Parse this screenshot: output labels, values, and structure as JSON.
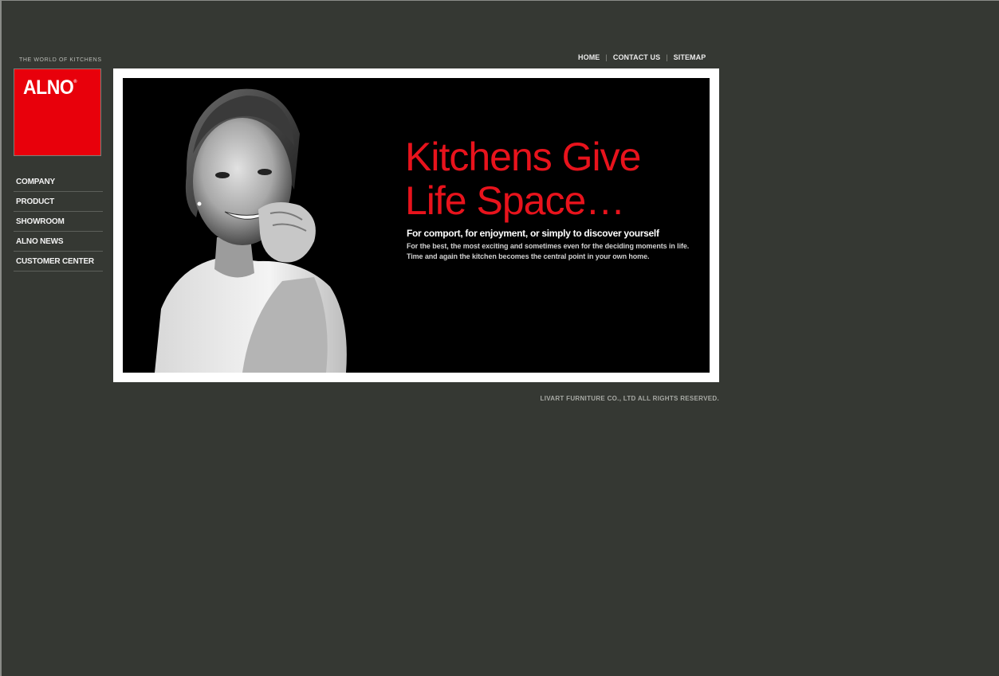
{
  "brand": {
    "tagline": "THE WORLD OF KITCHENS",
    "logo_text": "ALNO",
    "logo_mark": "®",
    "accent_color": "#e8000b"
  },
  "topnav": {
    "home": "HOME",
    "contact": "CONTACT US",
    "sitemap": "SITEMAP",
    "separator": "|"
  },
  "sidebar": {
    "items": [
      {
        "label": "COMPANY"
      },
      {
        "label": "PRODUCT"
      },
      {
        "label": "SHOWROOM"
      },
      {
        "label": "ALNO NEWS"
      },
      {
        "label": "CUSTOMER CENTER"
      }
    ]
  },
  "hero": {
    "headline_line1": "Kitchens Give",
    "headline_line2": "Life Space…",
    "subhead": "For comport, for enjoyment, or simply to discover yourself",
    "body_line1": "For the best, the most exciting and sometimes even for the deciding moments in life.",
    "body_line2": "Time and again the kitchen becomes the central point in your own home."
  },
  "footer": {
    "copyright": "LIVART FURNITURE CO., LTD ALL RIGHTS RESERVED."
  }
}
